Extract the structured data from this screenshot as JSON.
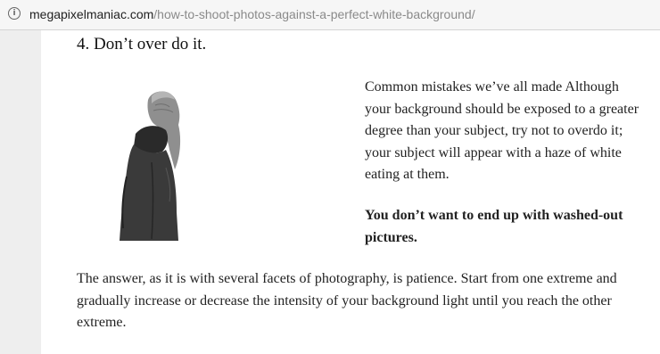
{
  "browser": {
    "url_host": "megapixelmaniac.com",
    "url_path": "/how-to-shoot-photos-against-a-perfect-white-background/",
    "info_icon": "info-icon"
  },
  "article": {
    "heading": "4. Don’t over do it.",
    "paragraph": "Common mistakes we’ve all made Although your background should be exposed to a greater degree than your subject, try not to overdo it; your subject will appear with a haze of white eating at them.",
    "bold_paragraph": "You don’t want to end up with washed-out pictures.",
    "closing_paragraph": "The answer, as it is with several facets of photography, is patience. Start from one extreme and gradually increase or decrease the intensity of your background light until you reach the other extreme."
  }
}
